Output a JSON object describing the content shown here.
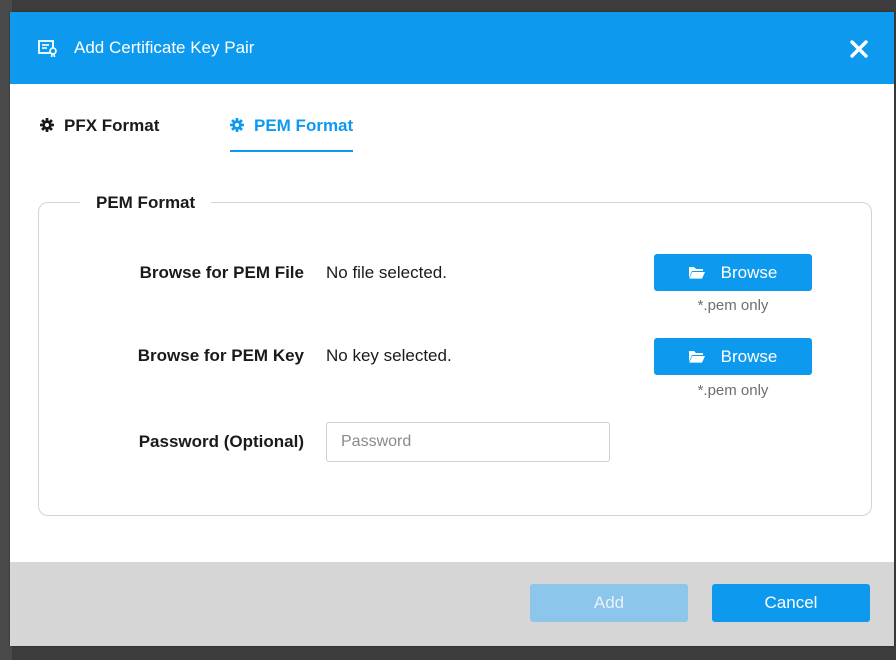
{
  "dialog": {
    "title": "Add Certificate Key Pair",
    "close_label": "✕"
  },
  "tabs": [
    {
      "label": "PFX Format",
      "active": false
    },
    {
      "label": "PEM Format",
      "active": true
    }
  ],
  "section": {
    "legend": "PEM Format"
  },
  "pem_file": {
    "label": "Browse for PEM File",
    "value": "No file selected.",
    "button_label": "Browse",
    "hint": "*.pem only"
  },
  "pem_key": {
    "label": "Browse for PEM Key",
    "value": "No key selected.",
    "button_label": "Browse",
    "hint": "*.pem only"
  },
  "password": {
    "label": "Password (Optional)",
    "placeholder": "Password",
    "value": ""
  },
  "footer": {
    "add_label": "Add",
    "add_enabled": false,
    "cancel_label": "Cancel"
  },
  "colors": {
    "accent": "#0d9aee",
    "accent_disabled": "#8cc6ea",
    "footer_bg": "#d6d6d6"
  }
}
